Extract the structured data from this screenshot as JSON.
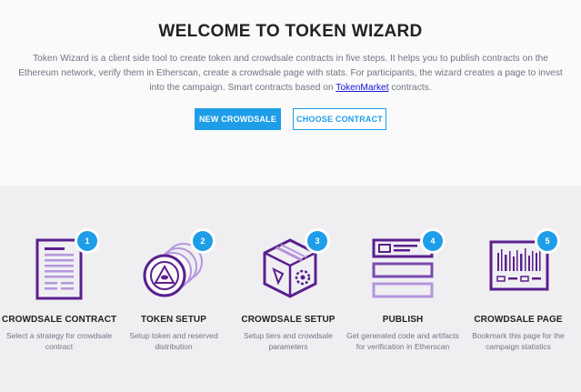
{
  "hero": {
    "title": "WELCOME TO TOKEN WIZARD",
    "description_before": "Token Wizard is a client side tool to create token and crowdsale contracts in five steps. It helps you to publish contracts on the Ethereum network, verify them in Etherscan, create a crowdsale page with stats. For participants, the wizard creates a page to invest into the campaign. Smart contracts based on ",
    "link_text": "TokenMarket",
    "description_after": " contracts.",
    "new_crowdsale_label": "NEW CROWDSALE",
    "choose_contract_label": "CHOOSE CONTRACT"
  },
  "colors": {
    "accent": "#1e9ee8",
    "icon_purple": "#5b1f8e",
    "icon_light": "#b695dc"
  },
  "steps": [
    {
      "number": "1",
      "title": "CROWDSALE CONTRACT",
      "description": "Select a strategy for crowdsale contract",
      "icon": "document-icon"
    },
    {
      "number": "2",
      "title": "TOKEN SETUP",
      "description": "Setup token and reserved distribution",
      "icon": "coin-stack-icon"
    },
    {
      "number": "3",
      "title": "CROWDSALE SETUP",
      "description": "Setup tiers and crowdsale parameters",
      "icon": "gear-box-icon"
    },
    {
      "number": "4",
      "title": "PUBLISH",
      "description": "Get generated code and artifacts for verification in Etherscan",
      "icon": "layers-icon"
    },
    {
      "number": "5",
      "title": "CROWDSALE PAGE",
      "description": "Bookmark this page for the campaign statistics",
      "icon": "barcode-page-icon"
    }
  ]
}
